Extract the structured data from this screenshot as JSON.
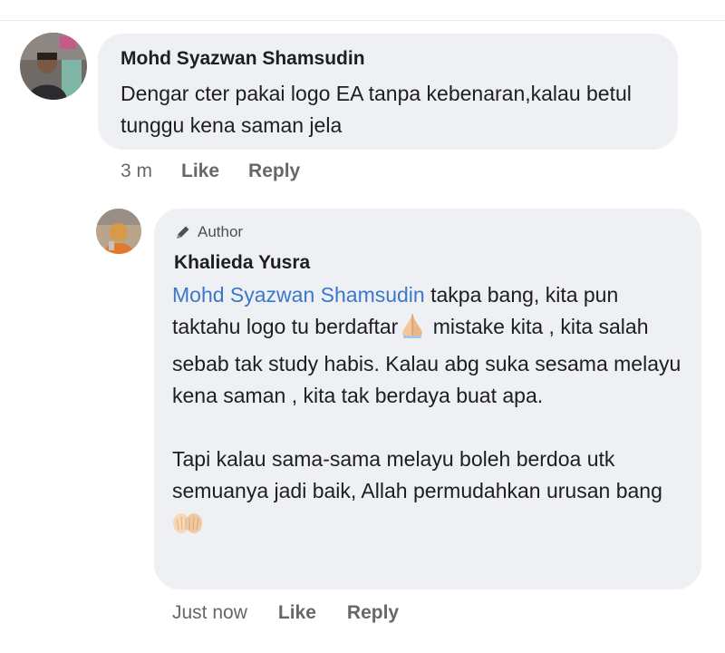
{
  "comments": [
    {
      "author": "Mohd Syazwan Shamsudin",
      "text": "Dengar cter pakai logo EA tanpa kebenaran,kalau betul tunggu kena saman jela",
      "time": "3 m",
      "like_label": "Like",
      "reply_label": "Reply"
    }
  ],
  "reply": {
    "badge": "Author",
    "author": "Khalieda Yusra",
    "mention": "Mohd Syazwan Shamsudin",
    "text_part1": " takpa bang, kita pun taktahu logo tu berdaftar",
    "text_part2": " mistake kita , kita salah sebab tak study habis. Kalau abg suka sesama melayu kena saman , kita tak berdaya buat apa.",
    "text_paragraph2": "Tapi kalau sama-sama melayu boleh berdoa utk semuanya jadi baik, Allah permudahkan urusan bang",
    "time": "Just now",
    "like_label": "Like",
    "reply_label": "Reply"
  },
  "icons": {
    "author_badge": "pencil-icon",
    "emoji_1": "folded-hands-emoji",
    "emoji_2": "open-hands-emoji"
  },
  "colors": {
    "bubble": "#eff0f4",
    "mention": "#3a78c9",
    "meta": "#65676b"
  }
}
